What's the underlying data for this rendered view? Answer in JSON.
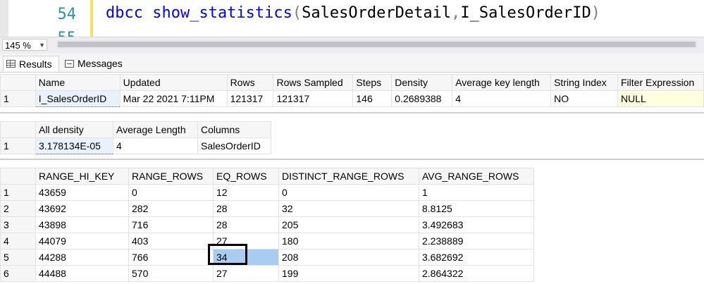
{
  "editor": {
    "line_numbers": [
      "54",
      "55"
    ],
    "code": {
      "function": "dbcc show_statistics",
      "open_paren": "(",
      "arg1": "SalesOrderDetail",
      "comma": ",",
      "arg2": "I_SalesOrderID",
      "close_paren": ")"
    }
  },
  "zoom": {
    "value": "145 %"
  },
  "tabs": [
    {
      "label": "Results",
      "icon": "grid-icon"
    },
    {
      "label": "Messages",
      "icon": "messages-icon"
    }
  ],
  "header_grid": {
    "columns": [
      "Name",
      "Updated",
      "Rows",
      "Rows Sampled",
      "Steps",
      "Density",
      "Average key length",
      "String Index",
      "Filter Expression"
    ],
    "rows": [
      {
        "num": "1",
        "cells": [
          "I_SalesOrderID",
          "Mar 22 2021  7:11PM",
          "121317",
          "121317",
          "146",
          "0.2689388",
          "4",
          "NO",
          "NULL"
        ]
      }
    ]
  },
  "density_grid": {
    "columns": [
      "All density",
      "Average Length",
      "Columns"
    ],
    "rows": [
      {
        "num": "1",
        "cells": [
          "3.178134E-05",
          "4",
          "SalesOrderID"
        ]
      }
    ]
  },
  "histogram_grid": {
    "columns": [
      "RANGE_HI_KEY",
      "RANGE_ROWS",
      "EQ_ROWS",
      "DISTINCT_RANGE_ROWS",
      "AVG_RANGE_ROWS"
    ],
    "rows": [
      {
        "num": "1",
        "cells": [
          "43659",
          "0",
          "12",
          "0",
          "1"
        ]
      },
      {
        "num": "2",
        "cells": [
          "43692",
          "282",
          "28",
          "32",
          "8.8125"
        ]
      },
      {
        "num": "3",
        "cells": [
          "43898",
          "716",
          "28",
          "205",
          "3.492683"
        ]
      },
      {
        "num": "4",
        "cells": [
          "44079",
          "403",
          "27",
          "180",
          "2.238889"
        ]
      },
      {
        "num": "5",
        "cells": [
          "44288",
          "766",
          "34",
          "208",
          "3.682692"
        ]
      },
      {
        "num": "6",
        "cells": [
          "44488",
          "570",
          "27",
          "199",
          "2.864322"
        ]
      }
    ]
  }
}
